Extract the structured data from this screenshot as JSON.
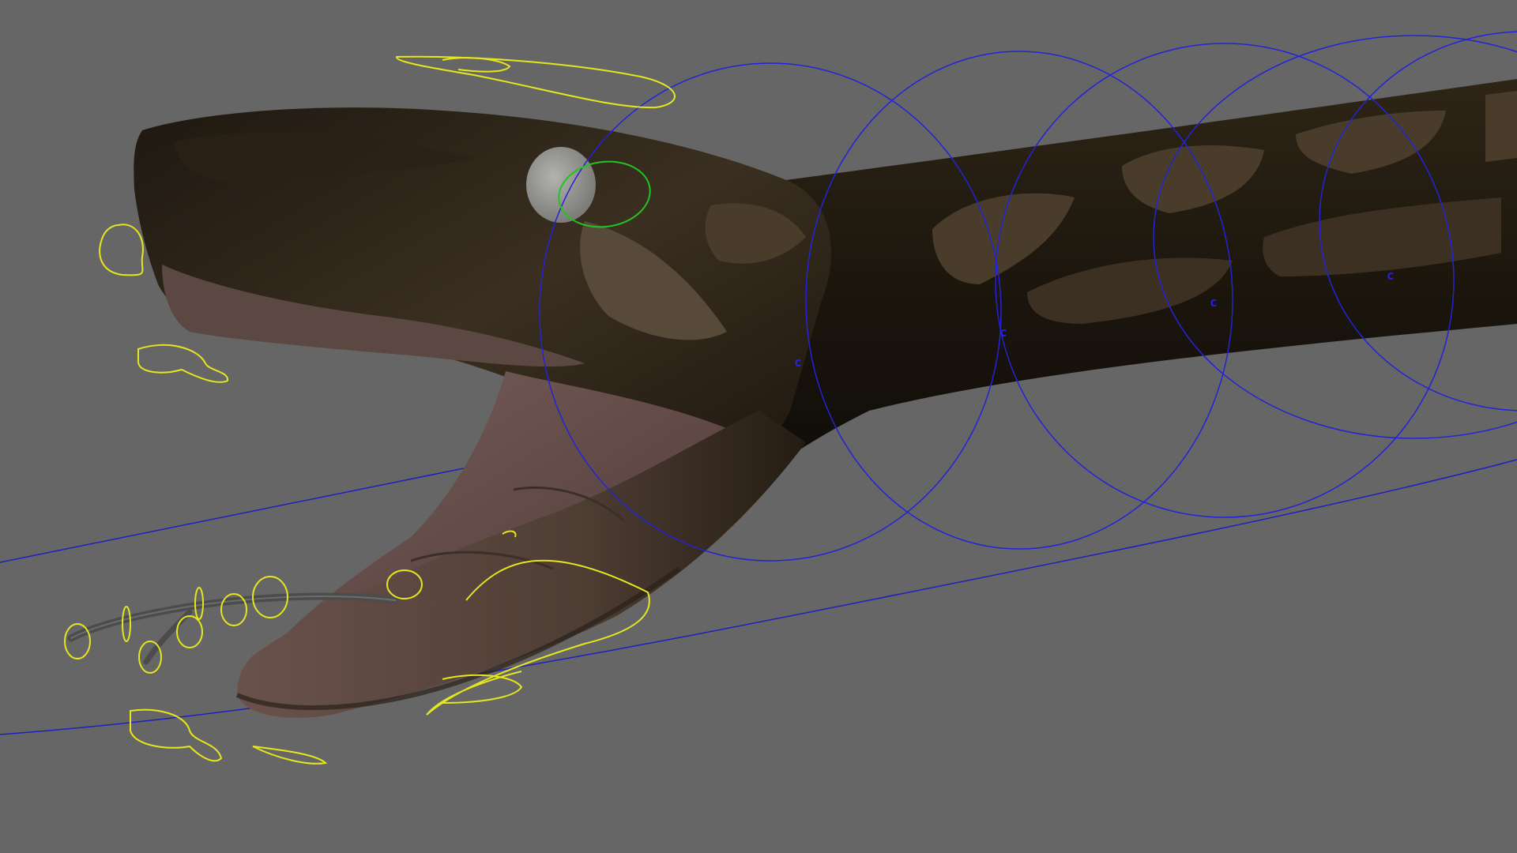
{
  "viewport": {
    "background": "#666666"
  },
  "colors": {
    "ik_spline_curve": "#1f1fc0",
    "spine_controls": "#2323d8",
    "facial_controls": "#e6e61e",
    "eye_control": "#22c422",
    "snake_body_dark": "#1a140c",
    "snake_pattern_tan": "#4a3c2a",
    "mouth_interior": "#6e5450",
    "eyeball": "#9a9a96",
    "tongue": "#4c4c4c"
  },
  "spine_controls": [
    {
      "label": "c"
    },
    {
      "label": "c"
    },
    {
      "label": "c"
    },
    {
      "label": "c"
    }
  ],
  "icons": {
    "eye_control": "circle-control-icon",
    "spine_control": "circle-control-icon",
    "facial_control": "loop-curve-control-icon"
  }
}
